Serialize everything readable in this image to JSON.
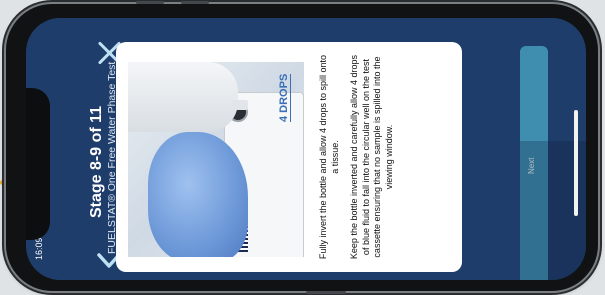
{
  "header": {
    "title": "Stage 8-9 of 11",
    "subtitle": "FUELSTAT® One Free Water Phase Test",
    "time": "16:09"
  },
  "card": {
    "image_label": "4 DROPS",
    "instruction_1": "Fully invert the bottle and allow 4 drops to spill onto a tissue.",
    "instruction_2": "Keep the bottle inverted and carefully allow 4 drops of blue fluid to fall into the circular well on the test cassette ensuring that no sample is spilled into the viewing window."
  },
  "footer": {
    "next_label": "Next"
  },
  "icons": {
    "close": "close-icon",
    "back": "chevron-down-icon"
  },
  "colors": {
    "background": "#1f3d6a",
    "accent": "#3f8eb0",
    "close_icon": "#bfe0f2"
  }
}
